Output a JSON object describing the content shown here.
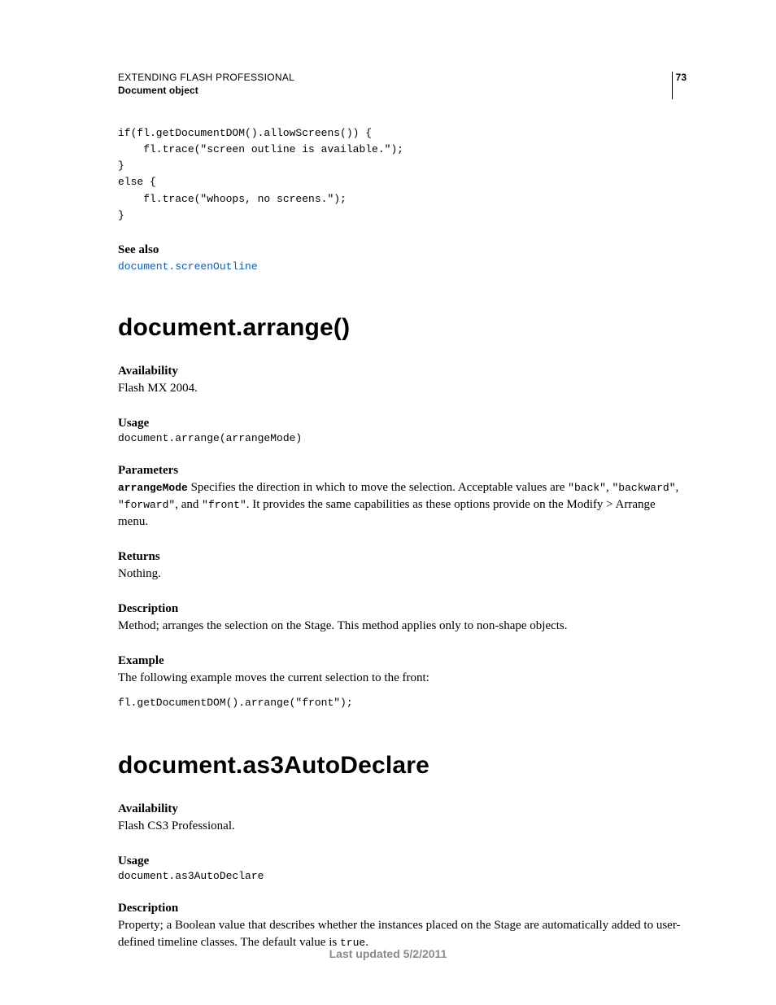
{
  "header": {
    "line1": "EXTENDING FLASH PROFESSIONAL",
    "line2": "Document object",
    "page_number": "73"
  },
  "top_code": "if(fl.getDocumentDOM().allowScreens()) {\n    fl.trace(\"screen outline is available.\");\n}\nelse {\n    fl.trace(\"whoops, no screens.\");\n}",
  "see_also": {
    "heading": "See also",
    "link_text": "document.screenOutline"
  },
  "arrange": {
    "title": "document.arrange()",
    "availability_head": "Availability",
    "availability_text": "Flash MX 2004.",
    "usage_head": "Usage",
    "usage_code": "document.arrange(arrangeMode)",
    "params_head": "Parameters",
    "param_name": "arrangeMode",
    "params_text_1": "  Specifies the direction in which to move the selection. Acceptable values are ",
    "val1": "\"back\"",
    "sep1": ", ",
    "val2": "\"backward\"",
    "sep2": ", ",
    "val3": "\"forward\"",
    "sep3": ", and ",
    "val4": "\"front\"",
    "params_text_2": ". It provides the same capabilities as these options provide on the Modify > Arrange menu.",
    "returns_head": "Returns",
    "returns_text": "Nothing.",
    "desc_head": "Description",
    "desc_text": "Method; arranges the selection on the Stage. This method applies only to non-shape objects.",
    "example_head": "Example",
    "example_text": "The following example moves the current selection to the front:",
    "example_code": "fl.getDocumentDOM().arrange(\"front\");"
  },
  "autodeclare": {
    "title": "document.as3AutoDeclare",
    "availability_head": "Availability",
    "availability_text": "Flash CS3 Professional.",
    "usage_head": "Usage",
    "usage_code": "document.as3AutoDeclare",
    "desc_head": "Description",
    "desc_text_1": "Property; a Boolean value that describes whether the instances placed on the Stage are automatically added to user-defined timeline classes. The default value is ",
    "desc_code": "true",
    "desc_text_2": "."
  },
  "footer": "Last updated 5/2/2011"
}
